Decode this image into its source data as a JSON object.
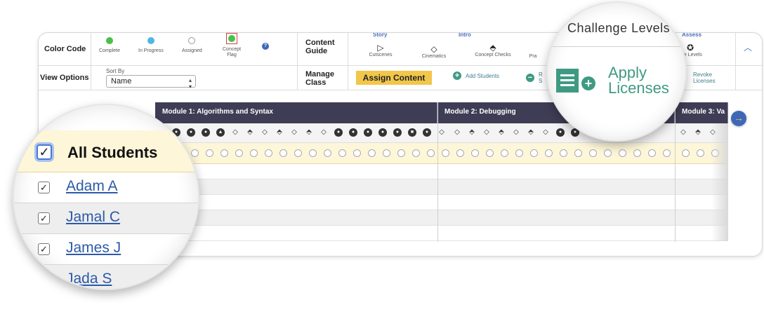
{
  "color_code": {
    "label": "Color Code",
    "items": [
      {
        "label": "Complete",
        "color": "#4bbf4b"
      },
      {
        "label": "In Progress",
        "color": "#4fb7e6"
      },
      {
        "label": "Assigned",
        "color": "#ffffff"
      },
      {
        "label": "Concept\nFlag",
        "color": "#4bbf4b"
      }
    ],
    "help": "?"
  },
  "content_guide": {
    "label": "Content Guide",
    "sections": {
      "story": "Story",
      "intro": "Intro",
      "assess": "Assess"
    },
    "items": [
      {
        "label": "Cutscenes",
        "icon": "play-outline-icon"
      },
      {
        "label": "Cinematics",
        "icon": "diamond-outline-icon"
      },
      {
        "label": "Concept Checks",
        "icon": "diamond-arrows-icon"
      },
      {
        "label": "Pra",
        "icon": ""
      },
      {
        "label": "one Levels",
        "icon": "x-circle-icon"
      }
    ]
  },
  "view_options": {
    "label": "View Options",
    "sort_by_label": "Sort By",
    "sort_value": "Name"
  },
  "manage_class": {
    "label": "Manage Class",
    "assign_button": "Assign Content",
    "add_students": "Add Students",
    "remove_fragment": "R\nS",
    "revoke_licenses": "Revoke Licenses"
  },
  "modules": [
    {
      "name": "Module 1: Algorithms and Syntax"
    },
    {
      "name": "Module 2: Debugging"
    },
    {
      "name": "Module 3: Va"
    }
  ],
  "magnifier_left": {
    "all_students": "All Students",
    "students": [
      "Adam A",
      "Jamal C",
      "James J",
      "Jada S"
    ]
  },
  "magnifier_right": {
    "challenge_levels": "Challenge Levels",
    "apply_licenses": "Apply Licenses"
  },
  "colors": {
    "module_bar": "#3f3d55",
    "accent_yellow": "#f2c64a",
    "teal": "#3f9a83",
    "link_blue": "#2c5aa8"
  }
}
